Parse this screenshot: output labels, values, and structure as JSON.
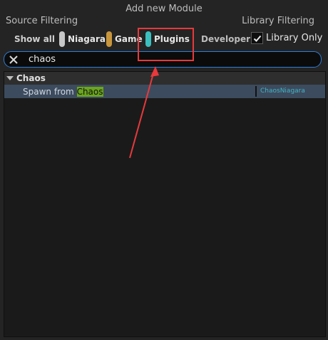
{
  "window": {
    "title": "Add new Module"
  },
  "source_filtering": {
    "label": "Source Filtering",
    "options": [
      {
        "label": "Show all"
      },
      {
        "label": "Niagara",
        "color": "#c8c8c8"
      },
      {
        "label": "Game",
        "color": "#c8963c"
      },
      {
        "label": "Plugins",
        "color": "#3cbfbf"
      },
      {
        "label": "Developer"
      }
    ]
  },
  "library_filtering": {
    "label": "Library Filtering",
    "library_only_label": "Library Only",
    "library_only_checked": true
  },
  "search": {
    "value": "chaos"
  },
  "results": {
    "categories": [
      {
        "name": "Chaos",
        "items": [
          {
            "prefix": "Spawn from ",
            "match": "Chaos",
            "source": "ChaosNiagara"
          }
        ]
      }
    ]
  },
  "colors": {
    "accent": "#2f7ed8",
    "highlight": "#6aa51e",
    "annotation": "#e8393c",
    "source_text": "#3fb5c6"
  }
}
